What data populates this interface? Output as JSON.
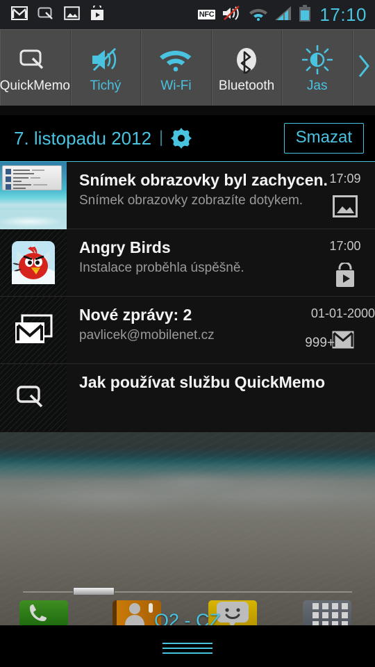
{
  "statusbar": {
    "left_icons": [
      "gmail-icon",
      "quickmemo-icon",
      "gallery-icon",
      "play-store-icon"
    ],
    "right_icons": [
      "nfc-icon",
      "silent-mode-icon",
      "wifi-icon",
      "signal-icon",
      "battery-icon"
    ],
    "nfc_label": "NFC",
    "clock": "17:10",
    "accent_color": "#49c3e0"
  },
  "quick_settings": {
    "tiles": [
      {
        "label": "QuickMemo",
        "icon": "quickmemo-icon",
        "state": "off"
      },
      {
        "label": "Tichý",
        "icon": "silent-mode-icon",
        "state": "on"
      },
      {
        "label": "Wi-Fi",
        "icon": "wifi-icon",
        "state": "on"
      },
      {
        "label": "Bluetooth",
        "icon": "bluetooth-icon",
        "state": "off"
      },
      {
        "label": "Jas",
        "icon": "brightness-icon",
        "state": "on"
      }
    ],
    "more_arrow": "chevron-right-icon"
  },
  "date_bar": {
    "date": "7. listopadu 2012",
    "separator": "|",
    "settings_icon": "gear-icon",
    "clear_label": "Smazat"
  },
  "notifications": [
    {
      "icon": "screenshot-thumbnail",
      "title": "Snímek obrazovky byl zachycen.",
      "subtitle": "Snímek obrazovky zobrazíte dotykem.",
      "time": "17:09",
      "app_icon": "gallery-icon",
      "count": ""
    },
    {
      "icon": "angry-birds-icon",
      "title": "Angry Birds",
      "subtitle": "Instalace proběhla úspěšně.",
      "time": "17:00",
      "app_icon": "play-store-icon",
      "count": ""
    },
    {
      "icon": "gmail-icon",
      "title": "Nové zprávy: 2",
      "subtitle": "pavlicek@mobilenet.cz",
      "time": "01-01-2000",
      "app_icon": "gmail-icon",
      "count": "999+"
    },
    {
      "icon": "quickmemo-icon",
      "title": "Jak používat službu QuickMemo",
      "subtitle": "",
      "time": "",
      "app_icon": "",
      "count": ""
    }
  ],
  "home": {
    "carrier": "O2 - CZ",
    "dock_items": [
      {
        "name": "phone-app-icon",
        "color": "#2e7d16"
      },
      {
        "name": "contacts-app-icon",
        "color": "#b06a07"
      },
      {
        "name": "messaging-app-icon",
        "color": "#c9a600"
      },
      {
        "name": "app-drawer-icon",
        "color": "#5c6068"
      }
    ],
    "drag_handle": "notification-drag-handle"
  }
}
